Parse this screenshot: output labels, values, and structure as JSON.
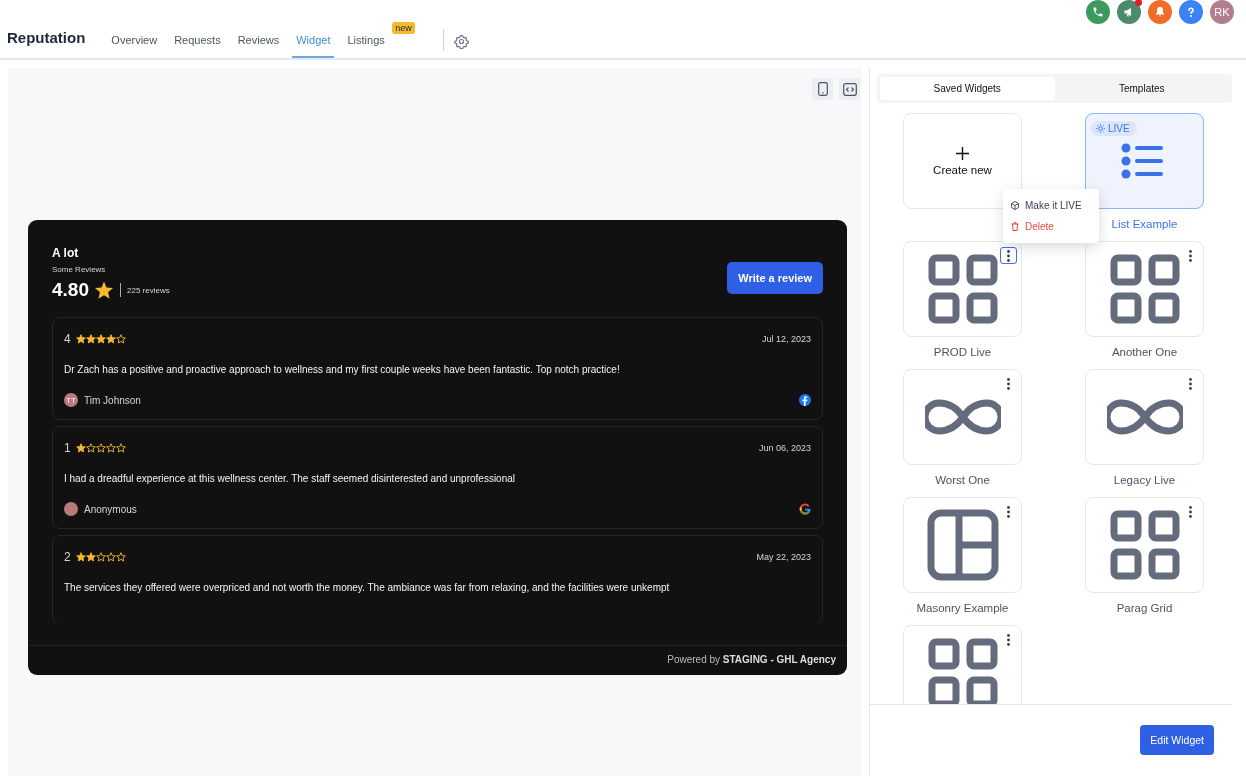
{
  "topbar": {
    "avatar": "RK",
    "notification_dot": true
  },
  "nav": {
    "title": "Reputation",
    "tabs": [
      {
        "label": "Overview",
        "selected": false
      },
      {
        "label": "Requests",
        "selected": false
      },
      {
        "label": "Reviews",
        "selected": false
      },
      {
        "label": "Widget",
        "selected": true
      },
      {
        "label": "Listings",
        "selected": false,
        "badge": "new"
      }
    ]
  },
  "preview": {
    "title": "A lot",
    "subtitle": "Some Reviews",
    "rating": "4.80",
    "review_count": "225 reviews",
    "write_button": "Write a review",
    "reviews": [
      {
        "score": "4",
        "stars": 4,
        "date": "Jul 12, 2023",
        "text": "Dr Zach has a positive and proactive approach to wellness and my first couple weeks have been fantastic. Top notch practice!",
        "author": "Tim Johnson",
        "initials": "TT",
        "kind": "facebook"
      },
      {
        "score": "1",
        "stars": 1,
        "date": "Jun 06, 2023",
        "text": "I had a dreadful experience at this wellness center. The staff seemed disinterested and unprofessional",
        "author": "Anonymous",
        "kind": "google"
      },
      {
        "score": "2",
        "stars": 2,
        "date": "May 22, 2023",
        "text": "The services they offered were overpriced and not worth the money. The ambiance was far from relaxing, and the facilities were unkempt"
      }
    ],
    "footer_prefix": "Powered by",
    "footer_brand": "STAGING - GHL Agency"
  },
  "panel": {
    "tabs": [
      {
        "label": "Saved Widgets",
        "selected": true
      },
      {
        "label": "Templates",
        "selected": false
      }
    ],
    "widgets": [
      {
        "kind": "create",
        "name": "Create new",
        "selected": false
      },
      {
        "kind": "list",
        "name": "List Example",
        "selected": true,
        "badge": "LIVE"
      },
      {
        "kind": "grid",
        "name": "PROD Live",
        "selected": false,
        "menu_open": true,
        "menu": [
          {
            "label": "Make it LIVE",
            "kind": "normal"
          },
          {
            "label": "Delete",
            "kind": "danger"
          }
        ]
      },
      {
        "kind": "grid",
        "name": "Another One",
        "selected": false
      },
      {
        "kind": "infinity",
        "name": "Worst One",
        "selected": false
      },
      {
        "kind": "infinity",
        "name": "Legacy Live",
        "selected": false
      },
      {
        "kind": "masonry",
        "name": "Masonry Example",
        "selected": false
      },
      {
        "kind": "grid",
        "name": "Parag Grid",
        "selected": false
      },
      {
        "kind": "grid",
        "selected": false
      }
    ],
    "edit_button": "Edit Widget"
  }
}
